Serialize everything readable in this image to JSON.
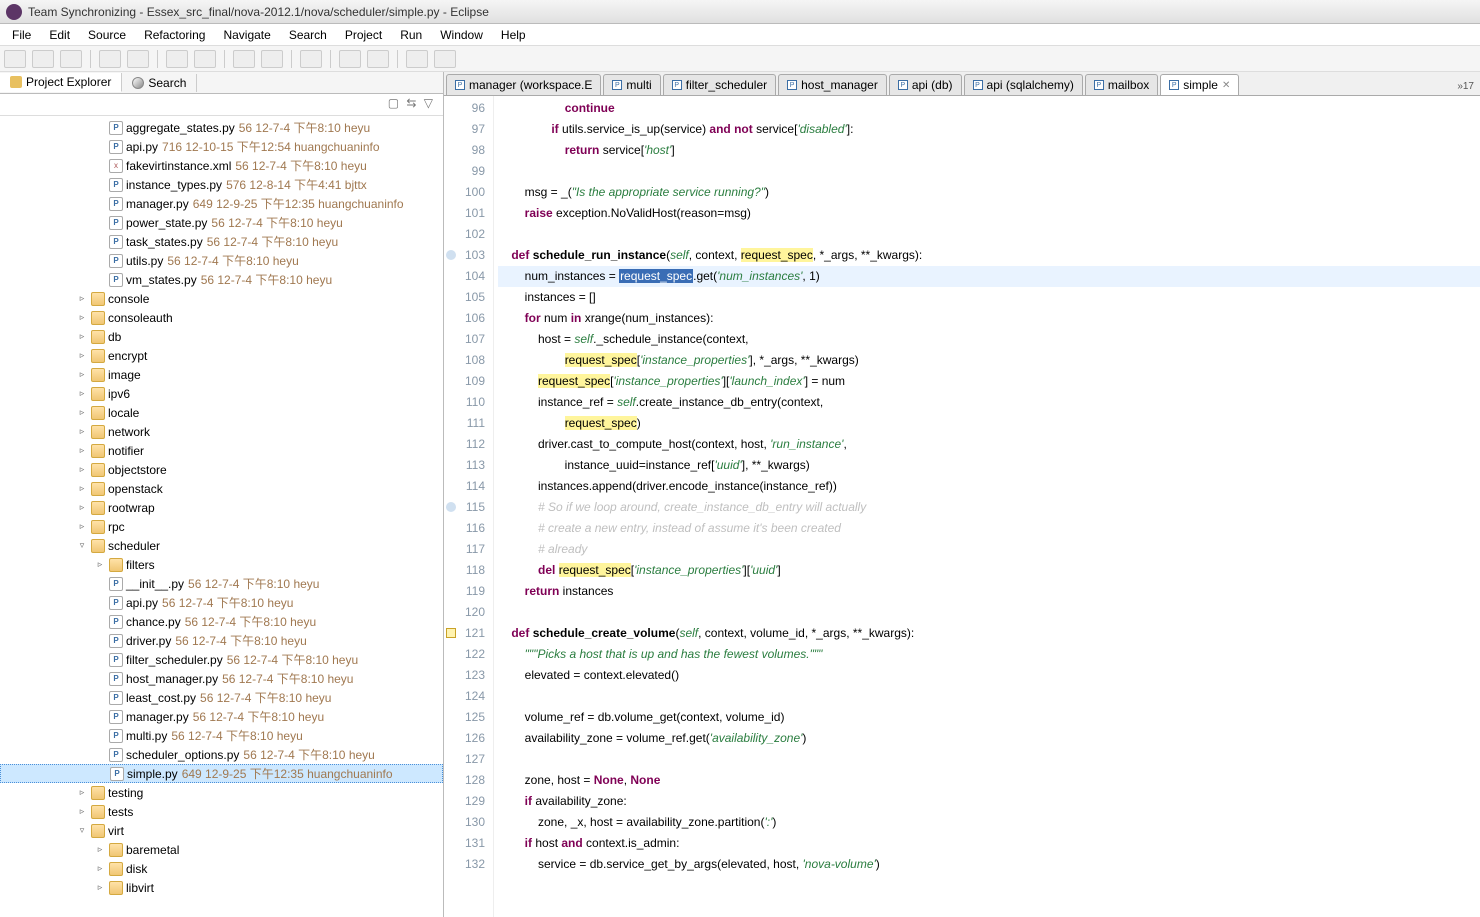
{
  "window": {
    "title": "Team Synchronizing - Essex_src_final/nova-2012.1/nova/scheduler/simple.py - Eclipse"
  },
  "menu": [
    "File",
    "Edit",
    "Source",
    "Refactoring",
    "Navigate",
    "Search",
    "Project",
    "Run",
    "Window",
    "Help"
  ],
  "left": {
    "tabs": {
      "explorer": "Project Explorer",
      "search": "Search"
    },
    "toolbar_icons": "▢ ⇆ ▽",
    "files_top": [
      {
        "t": "py",
        "name": "aggregate_states.py",
        "rev": "56",
        "date": "12-7-4 下午8:10",
        "who": "heyu",
        "indent": 5
      },
      {
        "t": "py",
        "name": "api.py",
        "rev": "716",
        "date": "12-10-15 下午12:54",
        "who": "huangchuaninfo",
        "indent": 5
      },
      {
        "t": "xml",
        "name": "fakevirtinstance.xml",
        "rev": "56",
        "date": "12-7-4 下午8:10",
        "who": "heyu",
        "indent": 5
      },
      {
        "t": "py",
        "name": "instance_types.py",
        "rev": "576",
        "date": "12-8-14 下午4:41",
        "who": "bjttx",
        "indent": 5
      },
      {
        "t": "py",
        "name": "manager.py",
        "rev": "649",
        "date": "12-9-25 下午12:35",
        "who": "huangchuaninfo",
        "indent": 5
      },
      {
        "t": "py",
        "name": "power_state.py",
        "rev": "56",
        "date": "12-7-4 下午8:10",
        "who": "heyu",
        "indent": 5
      },
      {
        "t": "py",
        "name": "task_states.py",
        "rev": "56",
        "date": "12-7-4 下午8:10",
        "who": "heyu",
        "indent": 5
      },
      {
        "t": "py",
        "name": "utils.py",
        "rev": "56",
        "date": "12-7-4 下午8:10",
        "who": "heyu",
        "indent": 5
      },
      {
        "t": "py",
        "name": "vm_states.py",
        "rev": "56",
        "date": "12-7-4 下午8:10",
        "who": "heyu",
        "indent": 5
      }
    ],
    "folders": [
      "console",
      "consoleauth",
      "db",
      "encrypt",
      "image",
      "ipv6",
      "locale",
      "network",
      "notifier",
      "objectstore",
      "openstack",
      "rootwrap",
      "rpc"
    ],
    "scheduler": {
      "name": "scheduler",
      "filters": "filters",
      "files": [
        {
          "t": "py",
          "name": "__init__.py",
          "rev": "56",
          "date": "12-7-4 下午8:10",
          "who": "heyu"
        },
        {
          "t": "py",
          "name": "api.py",
          "rev": "56",
          "date": "12-7-4 下午8:10",
          "who": "heyu"
        },
        {
          "t": "py",
          "name": "chance.py",
          "rev": "56",
          "date": "12-7-4 下午8:10",
          "who": "heyu"
        },
        {
          "t": "py",
          "name": "driver.py",
          "rev": "56",
          "date": "12-7-4 下午8:10",
          "who": "heyu"
        },
        {
          "t": "py",
          "name": "filter_scheduler.py",
          "rev": "56",
          "date": "12-7-4 下午8:10",
          "who": "heyu"
        },
        {
          "t": "py",
          "name": "host_manager.py",
          "rev": "56",
          "date": "12-7-4 下午8:10",
          "who": "heyu"
        },
        {
          "t": "py",
          "name": "least_cost.py",
          "rev": "56",
          "date": "12-7-4 下午8:10",
          "who": "heyu"
        },
        {
          "t": "py",
          "name": "manager.py",
          "rev": "56",
          "date": "12-7-4 下午8:10",
          "who": "heyu"
        },
        {
          "t": "py",
          "name": "multi.py",
          "rev": "56",
          "date": "12-7-4 下午8:10",
          "who": "heyu"
        },
        {
          "t": "py",
          "name": "scheduler_options.py",
          "rev": "56",
          "date": "12-7-4 下午8:10",
          "who": "heyu"
        },
        {
          "t": "py",
          "name": "simple.py",
          "rev": "649",
          "date": "12-9-25 下午12:35",
          "who": "huangchuaninfo",
          "selected": true
        }
      ]
    },
    "folders2": [
      "testing",
      "tests"
    ],
    "virt": {
      "name": "virt",
      "children": [
        "baremetal",
        "disk",
        "libvirt"
      ]
    }
  },
  "editor_tabs": [
    {
      "label": "manager (workspace.E"
    },
    {
      "label": "multi"
    },
    {
      "label": "filter_scheduler"
    },
    {
      "label": "host_manager"
    },
    {
      "label": "api (db)"
    },
    {
      "label": "api (sqlalchemy)"
    },
    {
      "label": "mailbox"
    },
    {
      "label": "simple",
      "active": true,
      "closeable": true
    }
  ],
  "editor_tabs_more": "»17",
  "code": {
    "start": 96,
    "ann": {
      "103": "q",
      "115": "q",
      "121": "w"
    }
  }
}
